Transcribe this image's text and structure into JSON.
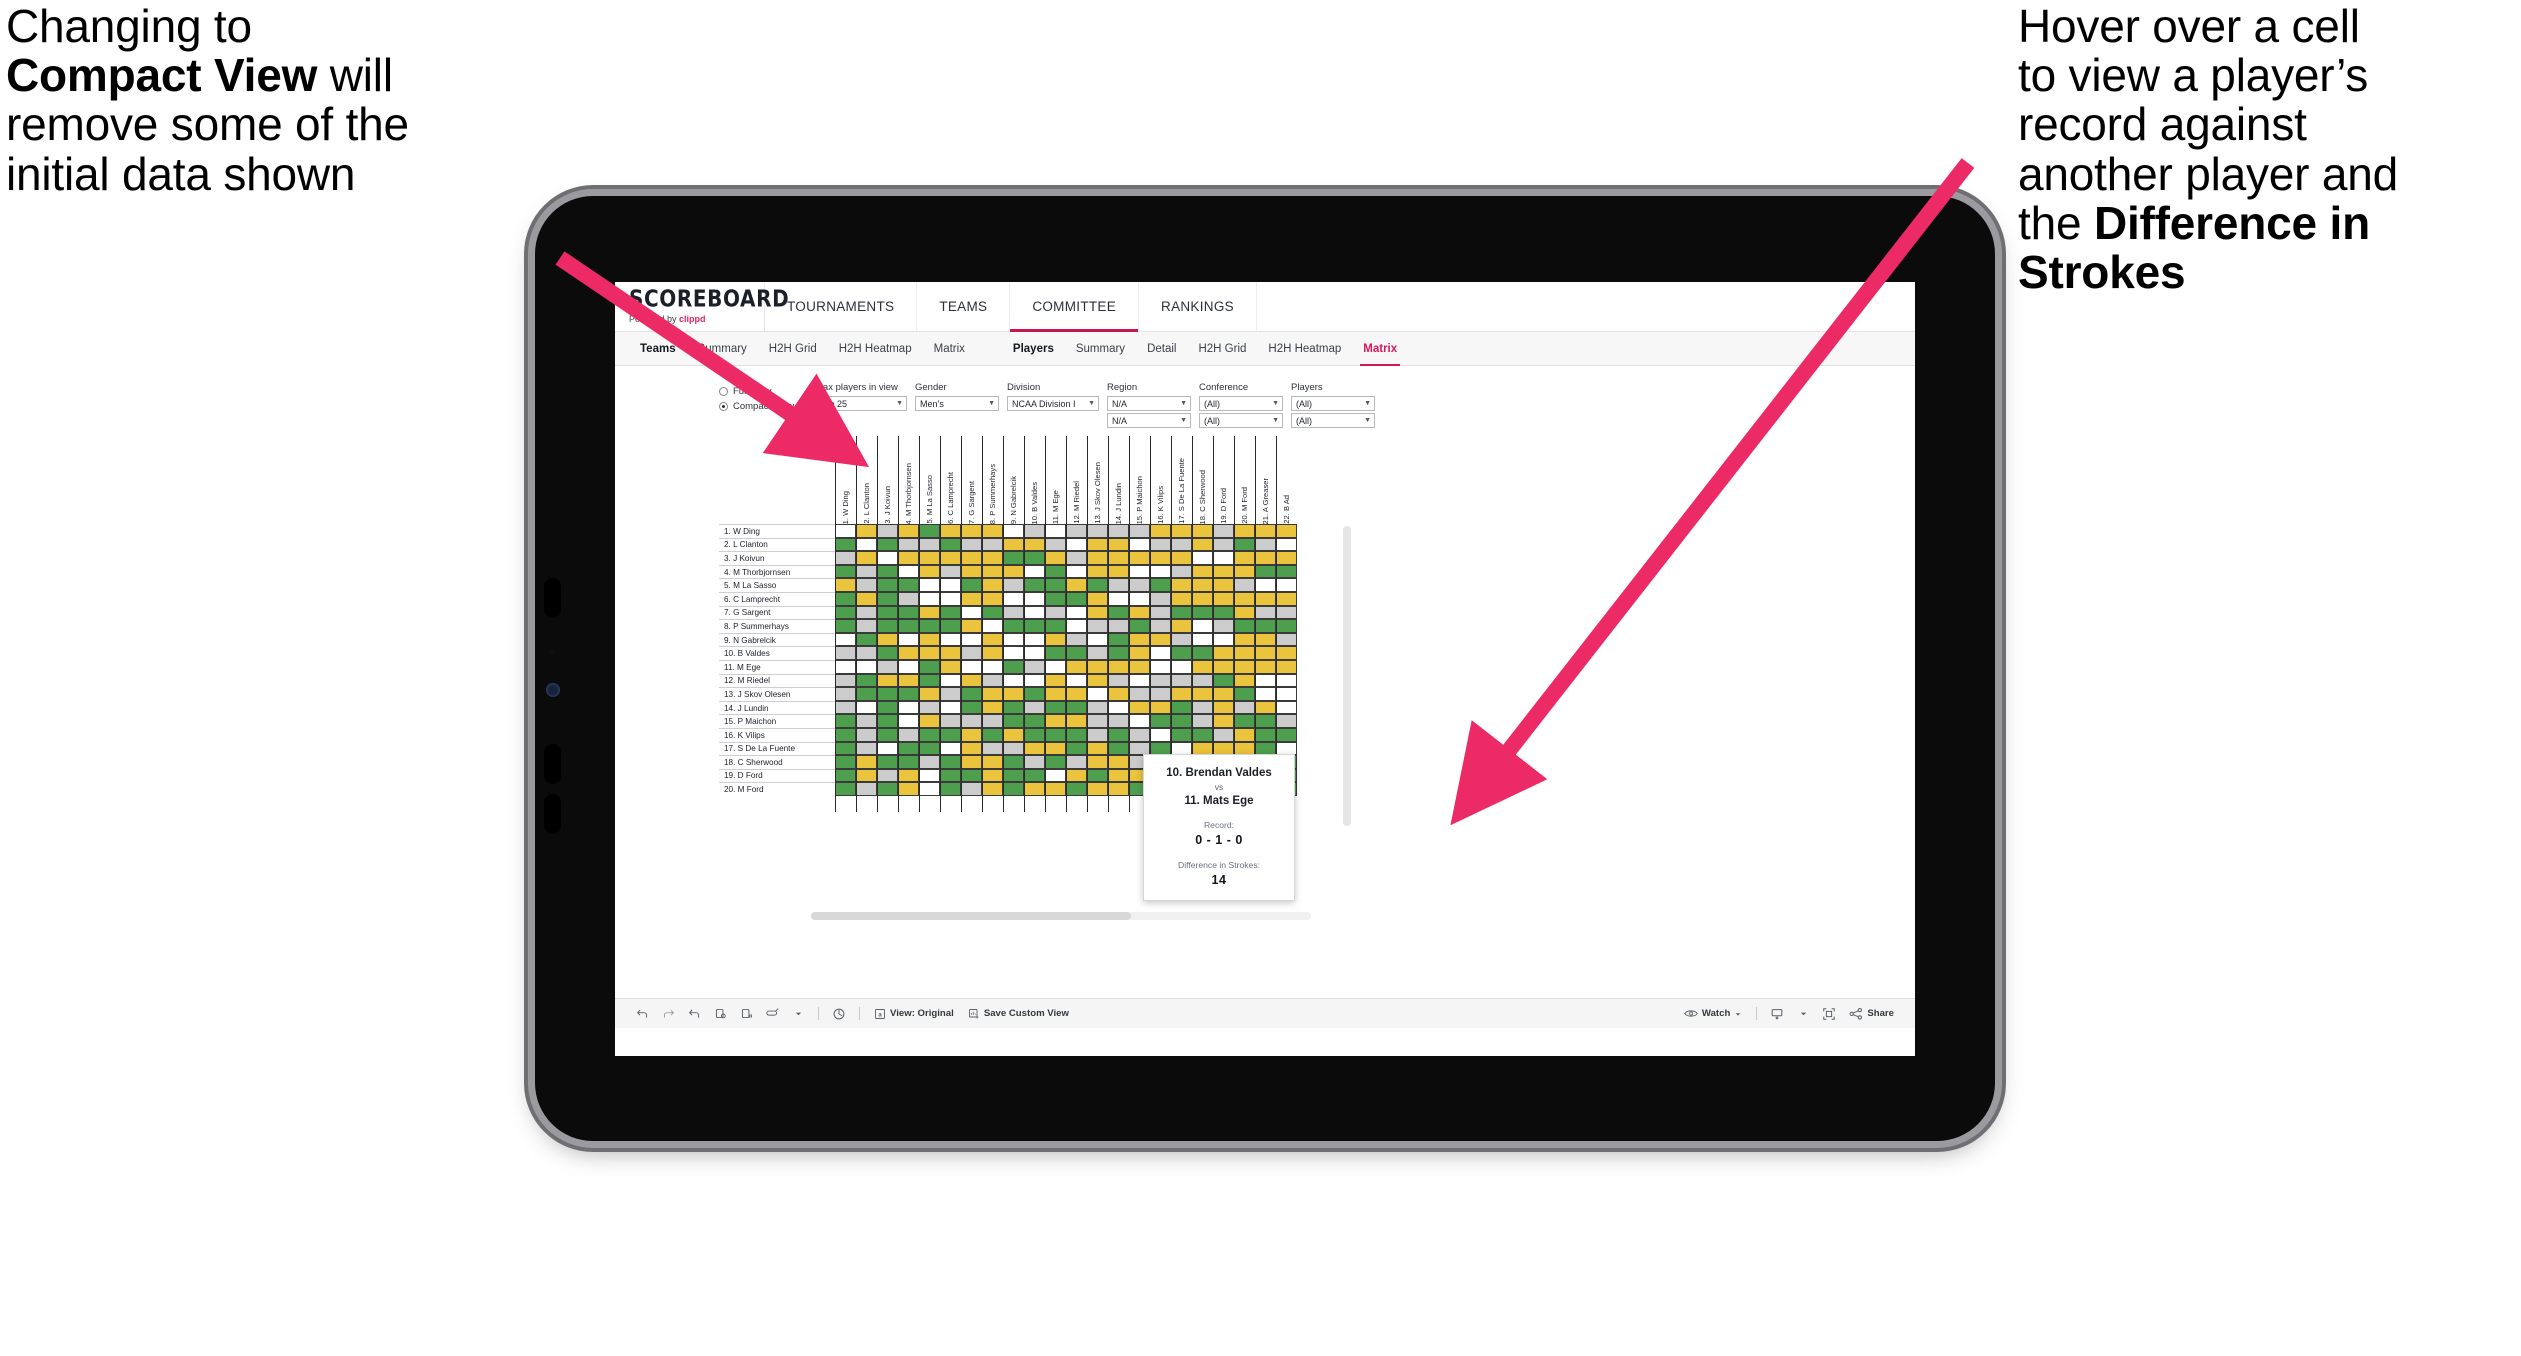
{
  "annotations": {
    "left": {
      "l1": "Changing to",
      "l2_bold": "Compact View",
      "l2_rest": " will",
      "l3": "remove some of the",
      "l4": "initial data shown"
    },
    "right": {
      "l1": "Hover over a cell",
      "l2": "to view a player’s",
      "l3": "record against",
      "l4": "another player and",
      "l5_rest": "the ",
      "l5_bold": "Difference in",
      "l6_bold": "Strokes"
    },
    "arrow_color": "#ec2a66"
  },
  "brand": {
    "logo": "SCOREBOARD",
    "powered_prefix": "Powered by ",
    "powered_name": "clippd"
  },
  "topnav": [
    {
      "label": "TOURNAMENTS",
      "active": false
    },
    {
      "label": "TEAMS",
      "active": false
    },
    {
      "label": "COMMITTEE",
      "active": true
    },
    {
      "label": "RANKINGS",
      "active": false
    }
  ],
  "subnav": {
    "group_teams": [
      {
        "label": "Teams",
        "head": true,
        "active": false
      },
      {
        "label": "Summary",
        "head": false,
        "active": false
      },
      {
        "label": "H2H Grid",
        "head": false,
        "active": false
      },
      {
        "label": "H2H Heatmap",
        "head": false,
        "active": false
      },
      {
        "label": "Matrix",
        "head": false,
        "active": false
      }
    ],
    "group_players": [
      {
        "label": "Players",
        "head": true,
        "active": false
      },
      {
        "label": "Summary",
        "head": false,
        "active": false
      },
      {
        "label": "Detail",
        "head": false,
        "active": false
      },
      {
        "label": "H2H Grid",
        "head": false,
        "active": false
      },
      {
        "label": "H2H Heatmap",
        "head": false,
        "active": false
      },
      {
        "label": "Matrix",
        "head": false,
        "active": true
      }
    ]
  },
  "filters": {
    "view_options": [
      {
        "label": "Full View",
        "selected": false
      },
      {
        "label": "Compact View",
        "selected": true
      }
    ],
    "max_players": {
      "label": "Max players in view",
      "value": "Top 25"
    },
    "gender": {
      "label": "Gender",
      "value": "Men’s"
    },
    "division": {
      "label": "Division",
      "value": "NCAA Division I"
    },
    "region": {
      "label": "Region",
      "value1": "N/A",
      "value2": "N/A"
    },
    "conference": {
      "label": "Conference",
      "value1": "(All)",
      "value2": "(All)"
    },
    "players": {
      "label": "Players",
      "value1": "(All)",
      "value2": "(All)"
    }
  },
  "matrix": {
    "rows": [
      "1. W Ding",
      "2. L Clanton",
      "3. J Koivun",
      "4. M Thorbjornsen",
      "5. M La Sasso",
      "6. C Lamprecht",
      "7. G Sargent",
      "8. P Summerhays",
      "9. N Gabrelcik",
      "10. B Valdes",
      "11. M Ege",
      "12. M Riedel",
      "13. J Skov Olesen",
      "14. J Lundin",
      "15. P Maichon",
      "16. K Vilips",
      "17. S De La Fuente",
      "18. C Sherwood",
      "19. D Ford",
      "20. M Ford"
    ],
    "columns": [
      "1. W Ding",
      "2. L Clanton",
      "3. J Koivun",
      "4. M Thorbjornsen",
      "5. M La Sasso",
      "6. C Lamprecht",
      "7. G Sargent",
      "8. P Summerhays",
      "9. N Gabrelcik",
      "10. B Valdes",
      "11. M Ege",
      "12. M Riedel",
      "13. J Skov Olesen",
      "14. J Lundin",
      "15. P Maichon",
      "16. K Vilips",
      "17. S De La Fuente",
      "18. C Sherwood",
      "19. D Ford",
      "20. M Ford",
      "21. A Greaser",
      "22. B Ad"
    ],
    "legend_colors": {
      "win": "#4d9f4e",
      "loss": "#e9c43c",
      "tie": "#cccccc",
      "none": "#ffffff"
    },
    "cells": [
      [
        "w",
        "y",
        "k",
        "y",
        "g",
        "y",
        "y",
        "y",
        "w",
        "k",
        "w",
        "k",
        "k",
        "k",
        "k",
        "y",
        "y",
        "y",
        "k",
        "y",
        "y",
        "y"
      ],
      [
        "g",
        "w",
        "g",
        "k",
        "k",
        "g",
        "k",
        "k",
        "y",
        "y",
        "k",
        "w",
        "y",
        "y",
        "w",
        "k",
        "k",
        "y",
        "k",
        "g",
        "k",
        "w"
      ],
      [
        "k",
        "y",
        "w",
        "y",
        "y",
        "y",
        "y",
        "y",
        "g",
        "g",
        "y",
        "k",
        "y",
        "y",
        "y",
        "y",
        "y",
        "w",
        "w",
        "y",
        "y",
        "y"
      ],
      [
        "g",
        "k",
        "g",
        "w",
        "y",
        "k",
        "y",
        "y",
        "y",
        "w",
        "g",
        "w",
        "y",
        "y",
        "w",
        "w",
        "k",
        "y",
        "y",
        "y",
        "g",
        "g"
      ],
      [
        "y",
        "k",
        "g",
        "g",
        "w",
        "w",
        "g",
        "y",
        "k",
        "g",
        "g",
        "y",
        "g",
        "k",
        "k",
        "g",
        "y",
        "y",
        "y",
        "k",
        "w",
        "w"
      ],
      [
        "g",
        "y",
        "g",
        "k",
        "w",
        "w",
        "y",
        "y",
        "w",
        "w",
        "g",
        "g",
        "y",
        "w",
        "w",
        "k",
        "y",
        "y",
        "y",
        "y",
        "y",
        "y"
      ],
      [
        "g",
        "k",
        "g",
        "g",
        "y",
        "g",
        "w",
        "g",
        "k",
        "w",
        "k",
        "w",
        "y",
        "g",
        "y",
        "k",
        "g",
        "g",
        "g",
        "y",
        "k",
        "k"
      ],
      [
        "g",
        "k",
        "g",
        "g",
        "g",
        "g",
        "y",
        "w",
        "g",
        "g",
        "g",
        "w",
        "k",
        "k",
        "g",
        "k",
        "y",
        "w",
        "k",
        "g",
        "g",
        "g"
      ],
      [
        "w",
        "g",
        "y",
        "w",
        "y",
        "w",
        "w",
        "y",
        "w",
        "w",
        "y",
        "k",
        "w",
        "g",
        "y",
        "y",
        "k",
        "w",
        "w",
        "y",
        "y",
        "k"
      ],
      [
        "k",
        "k",
        "g",
        "y",
        "y",
        "y",
        "k",
        "y",
        "w",
        "w",
        "g",
        "g",
        "k",
        "g",
        "y",
        "w",
        "g",
        "g",
        "y",
        "y",
        "y",
        "y"
      ],
      [
        "w",
        "w",
        "k",
        "w",
        "g",
        "y",
        "w",
        "w",
        "g",
        "k",
        "w",
        "y",
        "y",
        "y",
        "y",
        "w",
        "w",
        "y",
        "y",
        "y",
        "y",
        "y"
      ],
      [
        "k",
        "g",
        "y",
        "y",
        "g",
        "w",
        "y",
        "k",
        "w",
        "w",
        "y",
        "w",
        "y",
        "k",
        "w",
        "k",
        "k",
        "k",
        "g",
        "y",
        "w",
        "w"
      ],
      [
        "k",
        "g",
        "g",
        "g",
        "y",
        "k",
        "g",
        "y",
        "y",
        "g",
        "y",
        "y",
        "w",
        "y",
        "k",
        "k",
        "y",
        "y",
        "y",
        "g",
        "w",
        "w"
      ],
      [
        "k",
        "w",
        "g",
        "w",
        "k",
        "w",
        "g",
        "y",
        "g",
        "k",
        "g",
        "g",
        "k",
        "w",
        "y",
        "y",
        "g",
        "k",
        "y",
        "k",
        "y",
        "w"
      ],
      [
        "g",
        "k",
        "g",
        "w",
        "y",
        "k",
        "k",
        "k",
        "g",
        "g",
        "y",
        "y",
        "k",
        "k",
        "w",
        "g",
        "g",
        "k",
        "y",
        "g",
        "g",
        "k"
      ],
      [
        "g",
        "k",
        "g",
        "k",
        "g",
        "g",
        "y",
        "g",
        "y",
        "g",
        "g",
        "g",
        "k",
        "g",
        "k",
        "w",
        "g",
        "g",
        "k",
        "y",
        "g",
        "g"
      ],
      [
        "g",
        "k",
        "w",
        "g",
        "g",
        "w",
        "y",
        "k",
        "k",
        "y",
        "y",
        "g",
        "y",
        "g",
        "k",
        "g",
        "w",
        "y",
        "y",
        "y",
        "g",
        "w"
      ],
      [
        "g",
        "y",
        "g",
        "g",
        "k",
        "g",
        "y",
        "y",
        "g",
        "k",
        "g",
        "k",
        "y",
        "y",
        "k",
        "g",
        "y",
        "w",
        "y",
        "y",
        "y",
        "g"
      ],
      [
        "g",
        "y",
        "k",
        "y",
        "w",
        "g",
        "g",
        "y",
        "g",
        "g",
        "w",
        "y",
        "g",
        "y",
        "y",
        "g",
        "g",
        "w",
        "w",
        "g",
        "w",
        "g"
      ],
      [
        "g",
        "k",
        "g",
        "y",
        "w",
        "g",
        "k",
        "y",
        "g",
        "y",
        "y",
        "g",
        "y",
        "y",
        "g",
        "g",
        "g",
        "y",
        "k",
        "w",
        "g",
        "g"
      ]
    ]
  },
  "tooltip": {
    "player_a": "10. Brendan Valdes",
    "vs": "vs",
    "player_b": "11. Mats Ege",
    "record_label": "Record:",
    "record_value": "0 - 1 - 0",
    "diff_label": "Difference in Strokes:",
    "diff_value": "14"
  },
  "toolbar": {
    "icons": [
      "undo-icon",
      "redo-icon",
      "revert-icon",
      "refresh-data-icon",
      "pause-updates-icon",
      "highlight-icon",
      "dropdown-caret-icon"
    ],
    "dashboard_icon": "dashboard-icon",
    "view_original": "View: Original",
    "save_custom_view": "Save Custom View",
    "watch": "Watch",
    "share": "Share"
  }
}
